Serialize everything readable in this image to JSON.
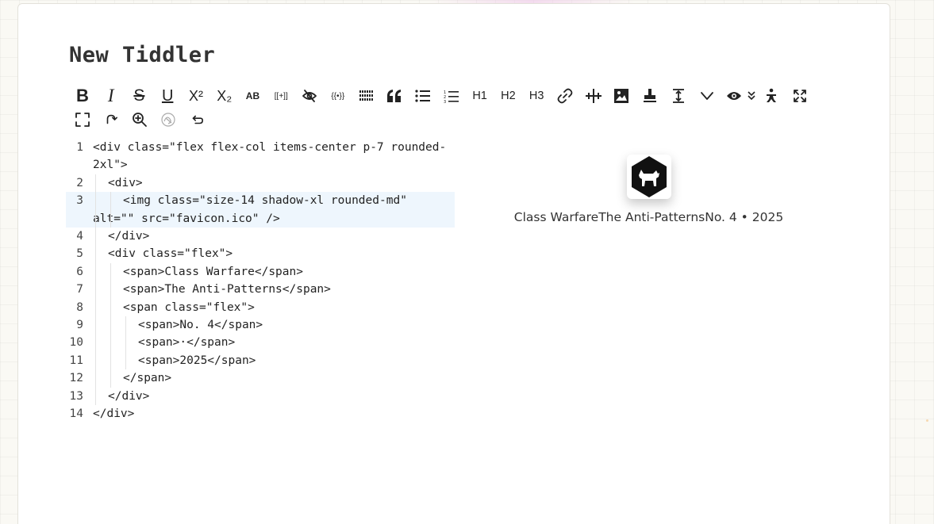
{
  "tiddler": {
    "title": "New Tiddler"
  },
  "toolbar": {
    "row1": [
      {
        "name": "bold-button",
        "label": "B",
        "style": "bold"
      },
      {
        "name": "italic-button",
        "label": "I",
        "style": "italic"
      },
      {
        "name": "strikethrough-button",
        "label": "S",
        "style": "strike"
      },
      {
        "name": "underline-button",
        "label": "U",
        "style": "underline"
      },
      {
        "name": "superscript-button",
        "label": "X²",
        "style": "sup"
      },
      {
        "name": "subscript-button",
        "label": "X₂",
        "style": "sub"
      },
      {
        "name": "smallcaps-button",
        "label": "AB",
        "style": "smallcaps"
      },
      {
        "name": "transclude-button",
        "label": "[[+]]",
        "style": "tiny"
      },
      {
        "name": "excise-button",
        "icon": "eye-slash-icon"
      },
      {
        "name": "macro-button",
        "label": "{{•}}",
        "style": "tiny"
      },
      {
        "name": "monospace-button",
        "icon": "mono-block-icon"
      },
      {
        "name": "quote-button",
        "icon": "quote-icon"
      },
      {
        "name": "bullet-list-button",
        "icon": "bullet-list-icon"
      },
      {
        "name": "numbered-list-button",
        "icon": "numbered-list-icon"
      },
      {
        "name": "heading-1-button",
        "label": "H1",
        "style": "heading"
      },
      {
        "name": "heading-2-button",
        "label": "H2",
        "style": "heading"
      },
      {
        "name": "heading-3-button",
        "label": "H3",
        "style": "heading"
      },
      {
        "name": "link-button",
        "icon": "link-icon"
      },
      {
        "name": "linkify-button",
        "icon": "linkify-icon"
      },
      {
        "name": "picture-button",
        "icon": "picture-icon"
      },
      {
        "name": "stamp-button",
        "icon": "stamp-icon"
      },
      {
        "name": "size-button",
        "icon": "size-icon"
      },
      {
        "name": "more-button",
        "icon": "chevron-down-icon"
      },
      {
        "name": "preview-button",
        "icon": "eye-icon"
      },
      {
        "name": "preview-type-button",
        "icon": "double-chevron-down-icon"
      },
      {
        "name": "person-button",
        "icon": "person-icon"
      },
      {
        "name": "fullscreen-button",
        "icon": "expand-icon"
      }
    ],
    "row2": [
      {
        "name": "editor-fullscreen-button",
        "icon": "corners-icon"
      },
      {
        "name": "rotate-button",
        "icon": "rotate-icon"
      },
      {
        "name": "zoom-button",
        "icon": "magnifier-icon"
      },
      {
        "name": "clear-button",
        "icon": "sketch-icon"
      },
      {
        "name": "undo-button",
        "icon": "undo-icon"
      }
    ]
  },
  "editor": {
    "lines": [
      {
        "n": "1",
        "text": "<div class=\"flex flex-col items-center p-7 rounded-2xl\">",
        "indent": 0,
        "wrap": true
      },
      {
        "n": "2",
        "text": "<div>",
        "indent": 1
      },
      {
        "n": "3",
        "text": "<img class=\"size-14 shadow-xl rounded-md\" alt=\"\" src=\"favicon.ico\" />",
        "indent": 2,
        "active": true
      },
      {
        "n": "4",
        "text": "</div>",
        "indent": 1
      },
      {
        "n": "5",
        "text": "<div class=\"flex\">",
        "indent": 1
      },
      {
        "n": "6",
        "text": "<span>Class Warfare</span>",
        "indent": 2
      },
      {
        "n": "7",
        "text": "<span>The Anti-Patterns</span>",
        "indent": 2
      },
      {
        "n": "8",
        "text": "<span class=\"flex\">",
        "indent": 2
      },
      {
        "n": "9",
        "text": "<span>No. 4</span>",
        "indent": 3
      },
      {
        "n": "10",
        "text": "<span>·</span>",
        "indent": 3
      },
      {
        "n": "11",
        "text": "<span>2025</span>",
        "indent": 3
      },
      {
        "n": "12",
        "text": "</span>",
        "indent": 2
      },
      {
        "n": "13",
        "text": "</div>",
        "indent": 1
      },
      {
        "n": "14",
        "text": "</div>",
        "indent": 0
      }
    ]
  },
  "preview": {
    "image_icon": "cat-hexagon-icon",
    "caption": [
      "Class Warfare",
      "The Anti-Patterns",
      "No. 4",
      " • ",
      "2025"
    ]
  }
}
